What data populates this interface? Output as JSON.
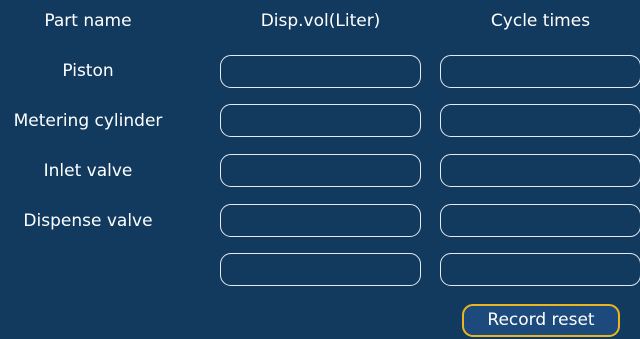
{
  "headers": {
    "part_name": "Part name",
    "disp_vol": "Disp.vol(Liter)",
    "cycle_times": "Cycle times"
  },
  "rows": [
    {
      "label": "Piston",
      "disp_vol": "",
      "cycle_times": ""
    },
    {
      "label": "Metering cylinder",
      "disp_vol": "",
      "cycle_times": ""
    },
    {
      "label": "Inlet valve",
      "disp_vol": "",
      "cycle_times": ""
    },
    {
      "label": "Dispense valve",
      "disp_vol": "",
      "cycle_times": ""
    },
    {
      "label": "",
      "disp_vol": "",
      "cycle_times": ""
    }
  ],
  "buttons": {
    "record_reset": "Record reset"
  },
  "colors": {
    "background": "#123a5f",
    "field_border": "#e6eaee",
    "button_border": "#e9b521",
    "button_fill": "#1d4a7d",
    "text": "#ffffff"
  }
}
